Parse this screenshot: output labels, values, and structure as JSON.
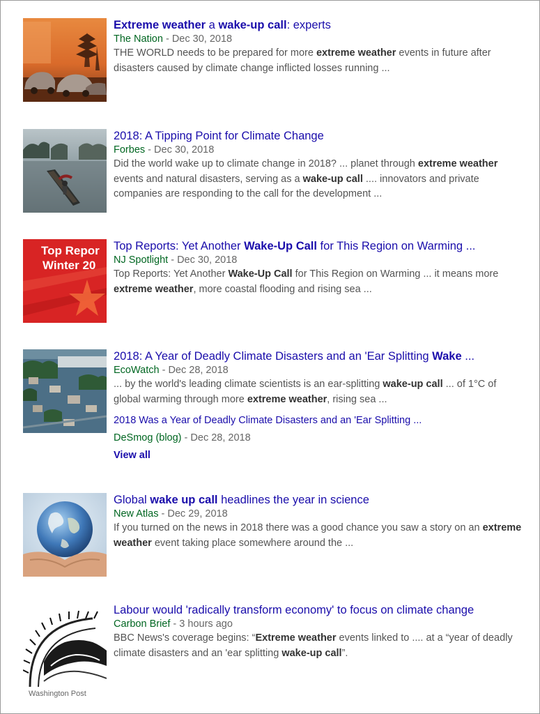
{
  "results": [
    {
      "title": [
        {
          "t": "Extreme weather",
          "b": true
        },
        {
          "t": " a ",
          "b": false
        },
        {
          "t": "wake-up call",
          "b": true
        },
        {
          "t": ": experts",
          "b": false
        }
      ],
      "source": "The Nation",
      "sep": " - ",
      "date": "Dec 30, 2018",
      "snippet": [
        {
          "t": "THE WORLD needs to be prepared for more ",
          "b": false
        },
        {
          "t": "extreme weather",
          "b": true
        },
        {
          "t": " events in future after disasters caused by climate change inflicted losses running ...",
          "b": false
        }
      ],
      "thumb_icon": "wildfire-thumbnail"
    },
    {
      "title": [
        {
          "t": "2018: A Tipping Point for Climate Change",
          "b": false
        }
      ],
      "source": "Forbes",
      "sep": " - ",
      "date": "Dec 30, 2018",
      "snippet": [
        {
          "t": "Did the world wake up to climate change in 2018? ... planet through ",
          "b": false
        },
        {
          "t": "extreme weather",
          "b": true
        },
        {
          "t": " events and natural disasters, serving as a ",
          "b": false
        },
        {
          "t": "wake-up call",
          "b": true
        },
        {
          "t": " .... innovators and private companies are responding to the call for the development ...",
          "b": false
        }
      ],
      "thumb_icon": "flood-boat-thumbnail"
    },
    {
      "title": [
        {
          "t": "Top Reports: Yet Another ",
          "b": false
        },
        {
          "t": "Wake-Up Call",
          "b": true
        },
        {
          "t": " for This Region on Warming ...",
          "b": false
        }
      ],
      "source": "NJ Spotlight",
      "sep": " - ",
      "date": "Dec 30, 2018",
      "snippet": [
        {
          "t": "Top Reports: Yet Another ",
          "b": false
        },
        {
          "t": "Wake-Up Call",
          "b": true
        },
        {
          "t": " for This Region on Warming ... it means more ",
          "b": false
        },
        {
          "t": "extreme weather",
          "b": true
        },
        {
          "t": ", more coastal flooding and rising sea ...",
          "b": false
        }
      ],
      "thumb_icon": "top-reports-thumbnail",
      "thumb_text": [
        "Top Repor",
        "Winter 20"
      ]
    },
    {
      "title": [
        {
          "t": "2018: A Year of Deadly Climate Disasters and an 'Ear Splitting ",
          "b": false
        },
        {
          "t": "Wake",
          "b": true
        },
        {
          "t": " ...",
          "b": false
        }
      ],
      "source": "EcoWatch",
      "sep": " - ",
      "date": "Dec 28, 2018",
      "snippet": [
        {
          "t": "... by the world's leading climate scientists is an ear-splitting ",
          "b": false
        },
        {
          "t": "wake-up call",
          "b": true
        },
        {
          "t": " ... of 1°C of global warming through more ",
          "b": false
        },
        {
          "t": "extreme weather",
          "b": true
        },
        {
          "t": ", rising sea ...",
          "b": false
        }
      ],
      "thumb_icon": "flooded-town-thumbnail",
      "related": {
        "title": "2018 Was a Year of Deadly Climate Disasters and an 'Ear Splitting ...",
        "source": "DeSmog (blog)",
        "sep": " - ",
        "date": "Dec 28, 2018"
      },
      "view_all": "View all"
    },
    {
      "title": [
        {
          "t": "Global ",
          "b": false
        },
        {
          "t": "wake up call",
          "b": true
        },
        {
          "t": " headlines the year in science",
          "b": false
        }
      ],
      "source": "New Atlas",
      "sep": " - ",
      "date": "Dec 29, 2018",
      "snippet": [
        {
          "t": "If you turned on the news in 2018 there was a good chance you saw a story on an ",
          "b": false
        },
        {
          "t": "extreme weather",
          "b": true
        },
        {
          "t": " event taking place somewhere around the ...",
          "b": false
        }
      ],
      "thumb_icon": "globe-in-hands-thumbnail"
    },
    {
      "title": [
        {
          "t": "Labour would 'radically transform economy' to focus on climate change",
          "b": false
        }
      ],
      "source": "Carbon Brief",
      "sep": " - ",
      "date": "3 hours ago",
      "snippet": [
        {
          "t": "BBC News's coverage begins: “",
          "b": false
        },
        {
          "t": "Extreme weather",
          "b": true
        },
        {
          "t": " events linked to .... at a “year of deadly climate disasters and an 'ear splitting ",
          "b": false
        },
        {
          "t": "wake-up call",
          "b": true
        },
        {
          "t": "”.",
          "b": false
        }
      ],
      "thumb_icon": "sun-sketch-thumbnail"
    }
  ],
  "caption": "Washington Post"
}
